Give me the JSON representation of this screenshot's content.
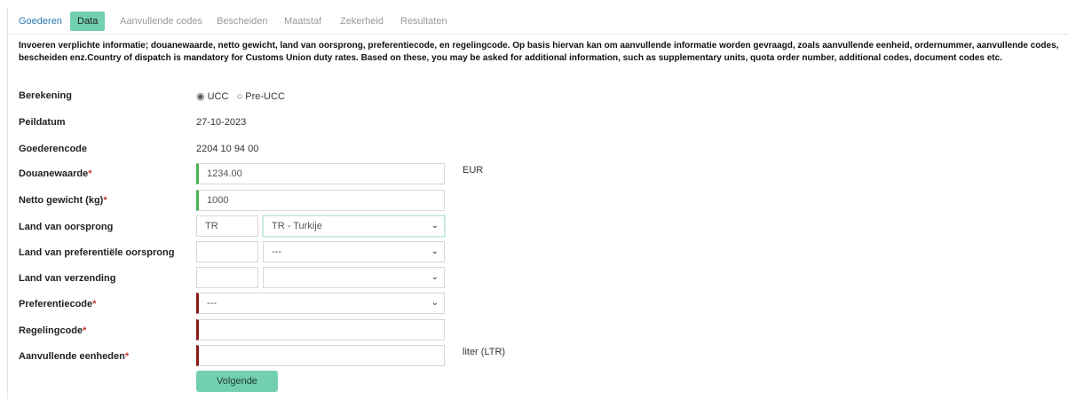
{
  "tabs": [
    "Goederen",
    "Data",
    "Aanvullende codes",
    "Bescheiden",
    "Maatstaf",
    "Zekerheid",
    "Resultaten"
  ],
  "intro_text": "Invoeren verplichte informatie; douanewaarde, netto gewicht, land van oorsprong, preferentiecode, en regelingcode. Op basis hiervan kan om aanvullende informatie worden gevraagd, zoals aanvullende eenheid, ordernummer, aanvullende codes, bescheiden enz.Country of dispatch is mandatory for Customs Union duty rates. Based on these, you may be asked for additional information, such as supplementary units, quota order number, additional codes, document codes etc.",
  "berekening": {
    "label": "Berekening",
    "options": [
      "UCC",
      "Pre-UCC"
    ],
    "selected": "UCC",
    "radio_on": "◉",
    "radio_off": "○"
  },
  "peildatum": {
    "label": "Peildatum",
    "value": "27-10-2023"
  },
  "goederencode": {
    "label": "Goederencode",
    "value": "2204 10 94 00"
  },
  "required_mark": "*",
  "douanewaarde": {
    "label": "Douanewaarde",
    "value": "1234.00",
    "unit": "EUR"
  },
  "netto_gewicht": {
    "label": "Netto gewicht (kg)",
    "value": "1000"
  },
  "land_oorsprong": {
    "label": "Land van oorsprong",
    "code": "TR",
    "selected": "TR - Turkije"
  },
  "land_pref_oorsprong": {
    "label": "Land van preferentiële oorsprong",
    "code": "",
    "selected": "---"
  },
  "land_verzending": {
    "label": "Land van verzending",
    "code": "",
    "selected": ""
  },
  "preferentiecode": {
    "label": "Preferentiecode",
    "selected": "---"
  },
  "regelingcode": {
    "label": "Regelingcode",
    "value": ""
  },
  "aanvullende_eenheden": {
    "label": "Aanvullende eenheden",
    "value": "",
    "unit": "liter (LTR)"
  },
  "chevron": "⌄",
  "next_button": "Volgende"
}
